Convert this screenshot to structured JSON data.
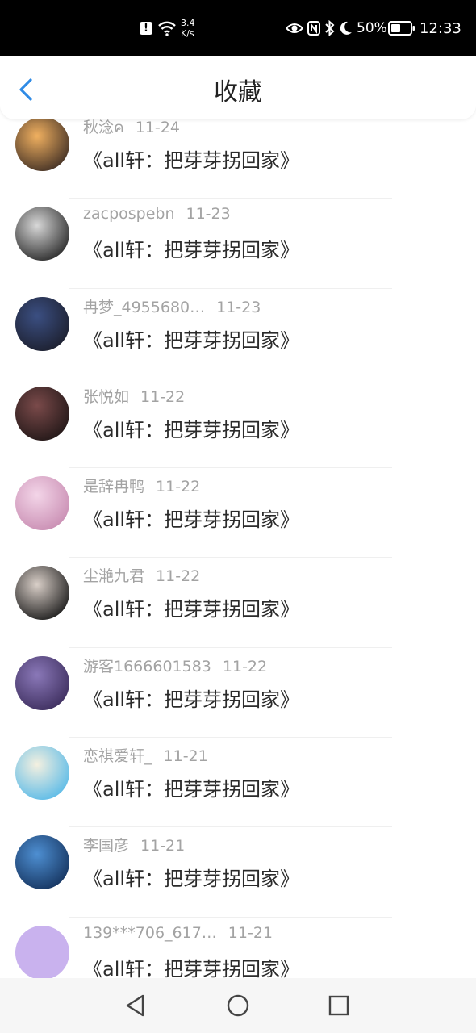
{
  "status_bar": {
    "alert_glyph": "!",
    "net_speed_value": "3.4",
    "net_speed_unit": "K/s",
    "battery": "50%",
    "time": "12:33"
  },
  "header": {
    "title": "收藏"
  },
  "items": [
    {
      "user": "秋淰ค",
      "date": "11-24",
      "work": "《all轩：把芽芽拐回家》",
      "avatar_colors": [
        "#f0b060",
        "#3a2a22"
      ]
    },
    {
      "user": "zacpospebn",
      "date": "11-23",
      "work": "《all轩：把芽芽拐回家》",
      "avatar_colors": [
        "#d8d8d8",
        "#222222"
      ]
    },
    {
      "user": "冉梦_4955680…",
      "date": "11-23",
      "work": "《all轩：把芽芽拐回家》",
      "avatar_colors": [
        "#3b4f82",
        "#1b1d2a"
      ]
    },
    {
      "user": "张悦如",
      "date": "11-22",
      "work": "《all轩：把芽芽拐回家》",
      "avatar_colors": [
        "#7a4a4a",
        "#1e1515"
      ]
    },
    {
      "user": "是辞冉鸭",
      "date": "11-22",
      "work": "《all轩：把芽芽拐回家》",
      "avatar_colors": [
        "#f3d5e8",
        "#c78ab0"
      ]
    },
    {
      "user": "尘滟九君",
      "date": "11-22",
      "work": "《all轩：把芽芽拐回家》",
      "avatar_colors": [
        "#d9cfc8",
        "#141414"
      ]
    },
    {
      "user": "游客1666601583",
      "date": "11-22",
      "work": "《all轩：把芽芽拐回家》",
      "avatar_colors": [
        "#8a78b8",
        "#3a2b5a"
      ]
    },
    {
      "user": "恋祺爱轩_",
      "date": "11-21",
      "work": "《all轩：把芽芽拐回家》",
      "avatar_colors": [
        "#f4f0e0",
        "#53b8e8"
      ]
    },
    {
      "user": "李国彦",
      "date": "11-21",
      "work": "《all轩：把芽芽拐回家》",
      "avatar_colors": [
        "#4e8fd2",
        "#13305a"
      ]
    },
    {
      "user": "139***706_617…",
      "date": "11-21",
      "work": "《all轩：把芽芽拐回家》",
      "avatar_colors": [
        "#c9b2ee",
        "#c9b2ee"
      ]
    }
  ],
  "accent_color": "#2f8be6"
}
